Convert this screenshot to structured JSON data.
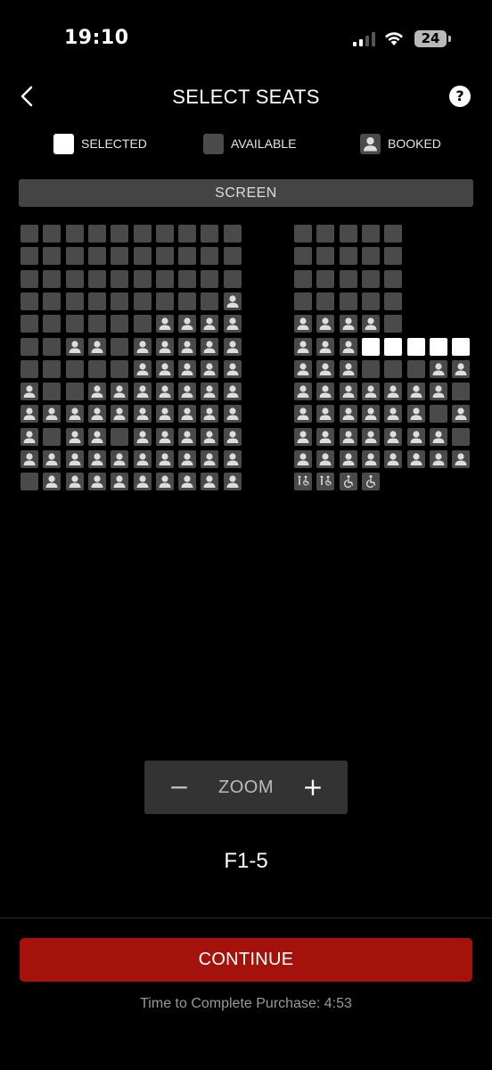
{
  "status_bar": {
    "time": "19:10",
    "battery": "24"
  },
  "header": {
    "title": "SELECT SEATS",
    "help_label": "?"
  },
  "legend": {
    "selected": "SELECTED",
    "available": "AVAILABLE",
    "booked": "BOOKED"
  },
  "screen_label": "SCREEN",
  "seat_map": {
    "legend_codes": {
      "A": "available",
      "B": "booked",
      "S": "selected",
      "W": "wheelchair-companion",
      "H": "wheelchair"
    },
    "left_block": [
      "AAAAAAAAAA",
      "AAAAAAAAAA",
      "AAAAAAAAAA",
      "AAAAAAAAAB",
      "AAAAAABBBB",
      "AABBABBBBB",
      "AAAAABBBBB",
      "BAABBBBBBB",
      "BBBBBBBBBB",
      "BABBABBBBB",
      "BBBBBBBBBB",
      "ABBBBBBBBB"
    ],
    "right_block": [
      "AAAAA",
      "AAAAA",
      "AAAAA",
      "AAAAA",
      "BBBBA",
      "BBBSSSSS",
      "BBBAAABB",
      "BBBBBBBA",
      "BBBBBBAB",
      "BBBBBBBA",
      "BBBBBBBB",
      "WWHH"
    ]
  },
  "zoom": {
    "minus": "−",
    "label": "ZOOM",
    "plus": "+"
  },
  "selection_text": "F1-5",
  "continue_label": "CONTINUE",
  "timer_text": "Time to Complete Purchase: 4:53",
  "colors": {
    "accent": "#a4120b",
    "seat": "#4a4a4a",
    "selected": "#ffffff",
    "background": "#000000"
  }
}
